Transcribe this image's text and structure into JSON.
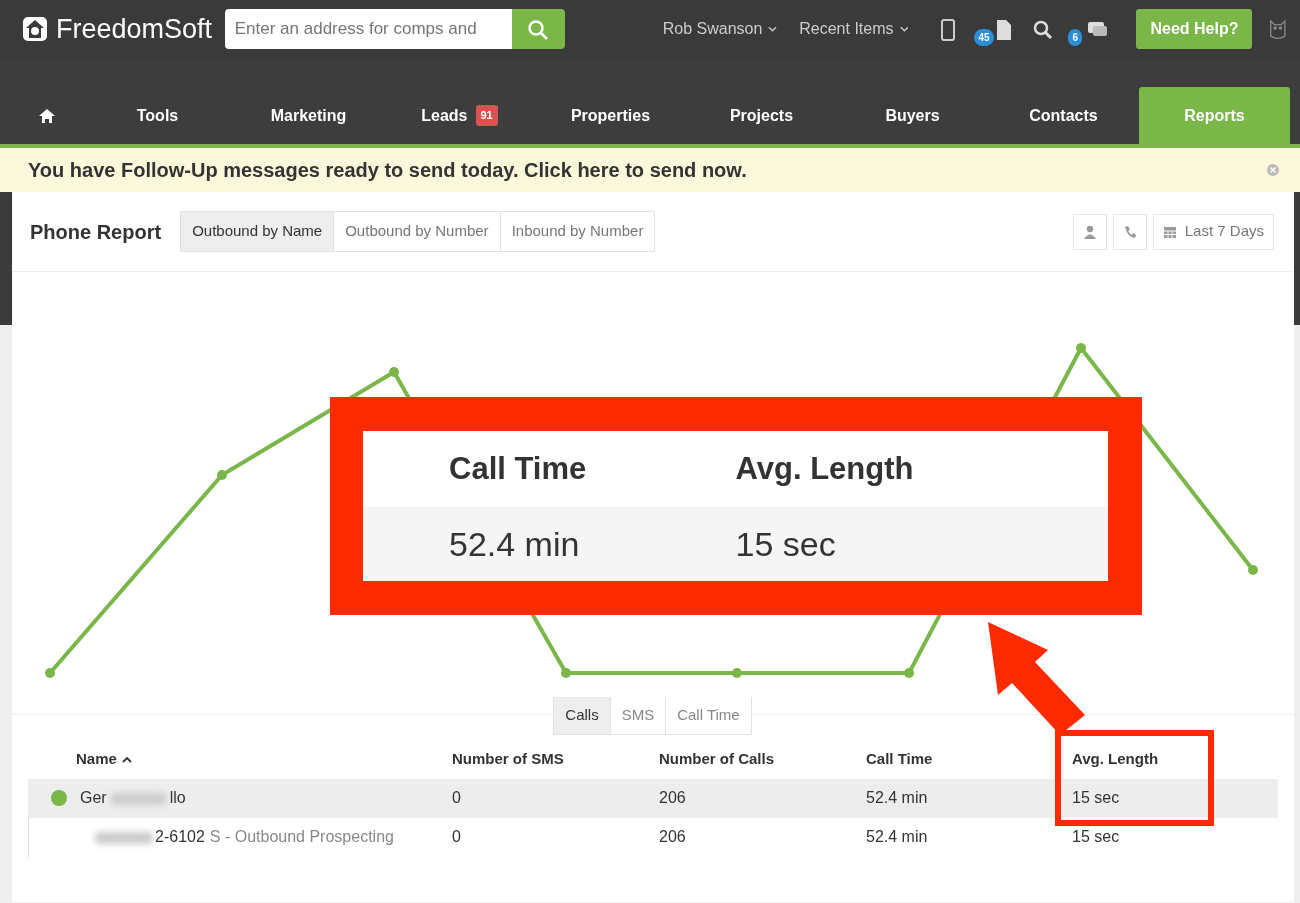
{
  "top_bar": {
    "logo": "FreedomSoft",
    "search": {
      "placeholder": "Enter an address for comps and"
    },
    "user_menu": "Rob Swanson",
    "recent_menu": "Recent Items",
    "icons": [
      {
        "kind": "phone"
      },
      {
        "kind": "document",
        "badge": "45"
      },
      {
        "kind": "search"
      },
      {
        "kind": "chat",
        "badge": "6"
      }
    ],
    "help_button": "Need Help?"
  },
  "nav_tabs": [
    {
      "kind": "home",
      "selected": false
    },
    {
      "kind": "text",
      "label": "Tools",
      "selected": false
    },
    {
      "kind": "text",
      "label": "Marketing",
      "selected": false
    },
    {
      "kind": "text",
      "label": "Leads",
      "badge": "91",
      "selected": false
    },
    {
      "kind": "text",
      "label": "Properties",
      "selected": false
    },
    {
      "kind": "text",
      "label": "Projects",
      "selected": false
    },
    {
      "kind": "text",
      "label": "Buyers",
      "selected": false
    },
    {
      "kind": "text",
      "label": "Contacts",
      "selected": false
    },
    {
      "kind": "text",
      "label": "Reports",
      "selected": true
    }
  ],
  "alert": {
    "message": "You have Follow-Up messages ready to send today. Click here to send now."
  },
  "report": {
    "title": "Phone Report",
    "view_tabs": [
      {
        "label": "Outbound by Name",
        "selected": true
      },
      {
        "label": "Outbound by Number",
        "selected": false
      },
      {
        "label": "Inbound by Number",
        "selected": false
      }
    ],
    "filter_buttons": [
      {
        "kind": "person"
      },
      {
        "kind": "phone"
      },
      {
        "kind": "calendar",
        "label": "Last 7 Days"
      }
    ]
  },
  "chart_toggle": [
    {
      "label": "Calls",
      "selected": true
    },
    {
      "label": "SMS",
      "selected": false
    },
    {
      "label": "Call Time",
      "selected": false
    }
  ],
  "table": {
    "columns": [
      {
        "label": "Name",
        "sorted": true
      },
      {
        "label": "Number of SMS",
        "sorted": false
      },
      {
        "label": "Number of Calls",
        "sorted": false
      },
      {
        "label": "Call Time",
        "sorted": false
      },
      {
        "label": "Avg. Length",
        "sorted": false
      }
    ],
    "rows": [
      {
        "kind": "person",
        "highlighted": true,
        "name_start": "Ger",
        "name_end": "llo",
        "sms": "0",
        "calls": "206",
        "call_time": "52.4 min",
        "avg_length": "15 sec"
      },
      {
        "kind": "number",
        "highlighted": false,
        "number_end": "2-6102",
        "campaign": "S - Outbound Prospecting",
        "sms": "0",
        "calls": "206",
        "call_time": "52.4 min",
        "avg_length": "15 sec"
      }
    ]
  },
  "callout": {
    "headers": [
      "Call Time",
      "Avg. Length"
    ],
    "values": [
      "52.4 min",
      "15 sec"
    ]
  }
}
